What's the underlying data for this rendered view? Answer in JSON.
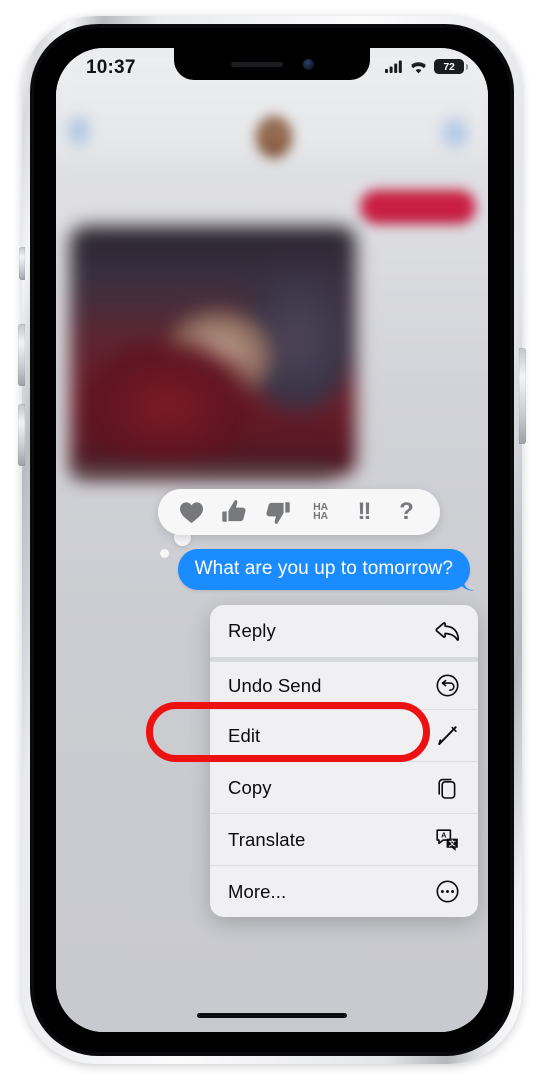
{
  "device": {
    "type": "iphone-with-notch",
    "frame_color": "#e9eaee"
  },
  "status_bar": {
    "time": "10:37",
    "cellular_icon": "cellular-bars-icon",
    "wifi_icon": "wifi-icon",
    "battery_level": "72",
    "battery_icon": "battery-icon"
  },
  "chat": {
    "background_dimmed": true,
    "nav_back_icon": "back-chevron-icon",
    "nav_avatar": "contact-avatar",
    "nav_right_icon": "facetime-video-icon",
    "blurred_incoming_bubble_color": "#c21c3c",
    "blurred_photo_attachment": "photo-attachment"
  },
  "tapback_bar": {
    "reactions": [
      {
        "name": "heart-reaction-icon",
        "label": "Heart"
      },
      {
        "name": "thumbs-up-reaction-icon",
        "label": "Thumbs Up"
      },
      {
        "name": "thumbs-down-reaction-icon",
        "label": "Thumbs Down"
      },
      {
        "name": "haha-reaction-icon",
        "line1": "HA",
        "line2": "HA"
      },
      {
        "name": "exclamation-reaction-icon",
        "glyph": "!!"
      },
      {
        "name": "question-reaction-icon",
        "glyph": "?"
      }
    ]
  },
  "message": {
    "text": "What are you up to tomorrow?",
    "direction": "outgoing",
    "bubble_color": "#1a8cff",
    "text_color": "#ffffff"
  },
  "context_menu": {
    "items": [
      {
        "label": "Reply",
        "icon": "reply-arrow-icon",
        "group": 0
      },
      {
        "label": "Undo Send",
        "icon": "undo-circle-icon",
        "group": 1
      },
      {
        "label": "Edit",
        "icon": "pencil-icon",
        "group": 1
      },
      {
        "label": "Copy",
        "icon": "copy-documents-icon",
        "group": 1
      },
      {
        "label": "Translate",
        "icon": "translate-icon",
        "group": 1
      },
      {
        "label": "More...",
        "icon": "ellipsis-circle-icon",
        "group": 1
      }
    ]
  },
  "annotation": {
    "highlight_target": "Edit",
    "color": "#ee1111",
    "shape": "rounded-rectangle-outline"
  },
  "home_indicator": {
    "visible": true
  }
}
